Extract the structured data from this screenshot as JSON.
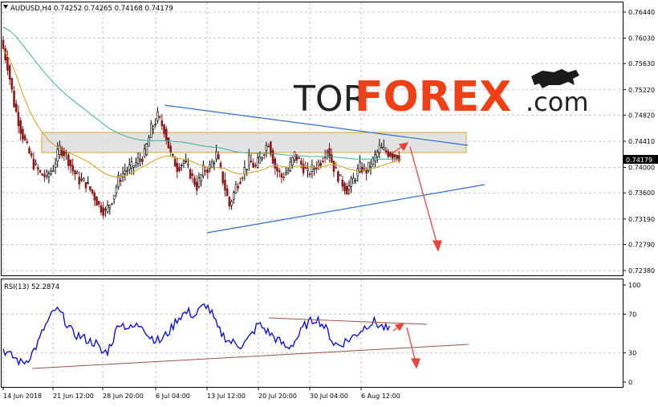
{
  "chart_data": [
    {
      "type": "line",
      "title": "AUDUSD,H4  0.74252 0.74265 0.74168 0.74179",
      "symbol": "AUDUSD",
      "timeframe": "H4",
      "ohlc": {
        "open": 0.74252,
        "high": 0.74265,
        "low": 0.74168,
        "close": 0.74179
      },
      "last_price": "0.74179",
      "y_ticks": [
        "0.76440",
        "0.76030",
        "0.75630",
        "0.75220",
        "0.74820",
        "0.74410",
        "0.74000",
        "0.73600",
        "0.73190",
        "0.72790",
        "0.72380"
      ],
      "ylim": [
        0.7238,
        0.7654
      ],
      "x_ticks": [
        "14 Jun 2018",
        "21 Jun 12:00",
        "28 Jun 20:00",
        "6 Jul 04:00",
        "13 Jul 12:00",
        "20 Jul 20:00",
        "30 Jul 04:00",
        "6 Aug 12:00"
      ],
      "series": [
        {
          "values": [
            0.76,
            0.756,
            0.75,
            0.746,
            0.743,
            0.7405,
            0.739,
            0.7385,
            0.74,
            0.743,
            0.742,
            0.7395,
            0.738,
            0.7375,
            0.736,
            0.734,
            0.733,
            0.735,
            0.738,
            0.7395,
            0.74,
            0.741,
            0.742,
            0.746,
            0.748,
            0.746,
            0.742,
            0.74,
            0.741,
            0.739,
            0.737,
            0.7395,
            0.74,
            0.742,
            0.738,
            0.734,
            0.737,
            0.739,
            0.741,
            0.74,
            0.742,
            0.744,
            0.74,
            0.7385,
            0.7395,
            0.742,
            0.7405,
            0.739,
            0.74,
            0.741,
            0.743,
            0.74,
            0.738,
            0.7365,
            0.738,
            0.74,
            0.7395,
            0.741,
            0.743,
            0.7425,
            0.742,
            0.7418
          ]
        },
        {
          "values": [
            0.7585,
            0.757,
            0.7545,
            0.7515,
            0.749,
            0.747,
            0.7455,
            0.7442,
            0.7434,
            0.7428,
            0.7423,
            0.7419,
            0.7414,
            0.7409,
            0.7402,
            0.7394,
            0.7388,
            0.7385,
            0.7385,
            0.7388,
            0.7393,
            0.7399,
            0.7404,
            0.741,
            0.7415,
            0.7418,
            0.7417,
            0.7414,
            0.7412,
            0.7409,
            0.7404,
            0.7401,
            0.7399,
            0.74,
            0.7398,
            0.7393,
            0.739,
            0.739,
            0.7392,
            0.7394,
            0.7397,
            0.7402,
            0.7403,
            0.7401,
            0.74,
            0.7402,
            0.7402,
            0.7401,
            0.74,
            0.7401,
            0.7404,
            0.7404,
            0.7401,
            0.7397,
            0.7395,
            0.7396,
            0.7397,
            0.7399,
            0.7403,
            0.7406,
            0.7409,
            0.7411
          ]
        },
        {
          "values": [
            0.762,
            0.7615,
            0.7605,
            0.7592,
            0.7579,
            0.7566,
            0.7553,
            0.7541,
            0.753,
            0.752,
            0.7511,
            0.7503,
            0.7495,
            0.7487,
            0.7479,
            0.7471,
            0.7463,
            0.7457,
            0.7452,
            0.7448,
            0.7445,
            0.7443,
            0.7442,
            0.7442,
            0.7442,
            0.7442,
            0.7441,
            0.744,
            0.7439,
            0.7437,
            0.7435,
            0.7433,
            0.7432,
            0.7431,
            0.7429,
            0.7426,
            0.7424,
            0.7423,
            0.7422,
            0.7422,
            0.7422,
            0.7422,
            0.7421,
            0.742,
            0.7419,
            0.7418,
            0.7418,
            0.7417,
            0.7417,
            0.7417,
            0.7417,
            0.7416,
            0.7415,
            0.7414,
            0.7413,
            0.7413,
            0.7413,
            0.7413,
            0.7413,
            0.7413,
            0.7413,
            0.7413
          ]
        }
      ],
      "colors": {
        "bull": "#000000",
        "bear": "#8b1a1a",
        "ma_fast": "#d4a017",
        "ma_slow": "#3cb39b",
        "trend": "#2f6fd6",
        "zone": "#d9d9d9",
        "zone_border": "#e0a030",
        "arrow": "#e8453c"
      },
      "annotations": {
        "resistance_zone": [
          0.7432,
          0.7453
        ],
        "forecast_arrows": true
      }
    },
    {
      "type": "line",
      "title": "RSI(13) 52.2874",
      "y_ticks": [
        "100",
        "70",
        "30",
        "0"
      ],
      "ylim": [
        0,
        100
      ],
      "series": [
        {
          "values": [
            34,
            28,
            25,
            20,
            22,
            30,
            40,
            55,
            65,
            75,
            70,
            60,
            50,
            48,
            45,
            42,
            40,
            30,
            32,
            45,
            62,
            58,
            55,
            58,
            60,
            48,
            45,
            42,
            48,
            55,
            65,
            70,
            72,
            68,
            75,
            80,
            70,
            55,
            48,
            42,
            40,
            38,
            42,
            50,
            60,
            55,
            50,
            45,
            40,
            35,
            40,
            48,
            58,
            62,
            66,
            60,
            52,
            40,
            38,
            42,
            45,
            50,
            55,
            60,
            62,
            58,
            55,
            52
          ]
        }
      ],
      "colors": {
        "rsi": "#0000ee",
        "trend": "#a0504a",
        "arrow": "#e8453c"
      }
    }
  ],
  "watermark": {
    "prefix": "TOR",
    "brand": "FOREX",
    "suffix": ".com"
  }
}
